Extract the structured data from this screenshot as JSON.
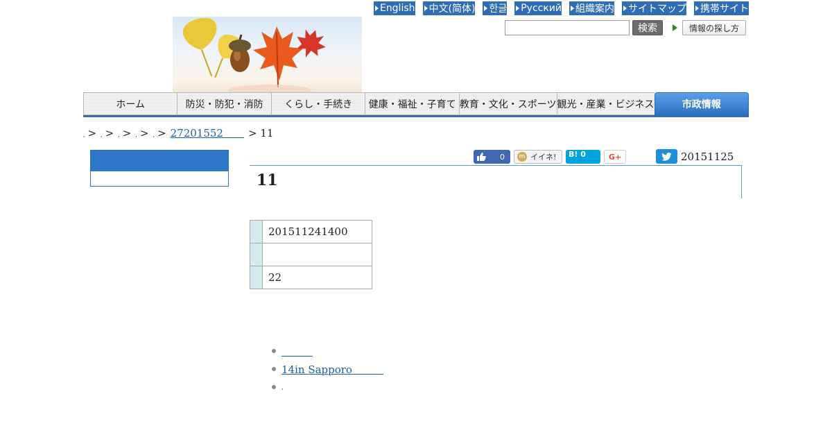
{
  "toplinks": [
    "English",
    "中文(简体)",
    "한글",
    "Русский",
    "組織案内",
    "サイトマップ",
    "携帯サイト"
  ],
  "search": {
    "button": "検索",
    "guide": "情報の探し方",
    "value": ""
  },
  "nav": [
    "ホーム",
    "防災・防犯・消防",
    "くらし・手続き",
    "健康・福祉・子育て",
    "教育・文化・スポーツ",
    "観光・産業・ビジネス",
    "市政情報"
  ],
  "breadcrumb": {
    "sep": ">",
    "comma": ",",
    "link": "27201552　　",
    "current": "> 11"
  },
  "social": {
    "fb_count": "0",
    "mixi_label": "イイネ!",
    "hatena_label": "B! 0",
    "gplus_label": "G+"
  },
  "pubdate": "20151125",
  "article": {
    "title": "11"
  },
  "table": [
    "201511241400",
    "",
    "22"
  ],
  "related": {
    "link1": "　　　",
    "link2": "14in Sapporo　　　",
    "item3": ","
  },
  "colors": {
    "accent": "#2f6db5",
    "nav_active": "#2d72c4",
    "table_header": "#d5ecec"
  }
}
